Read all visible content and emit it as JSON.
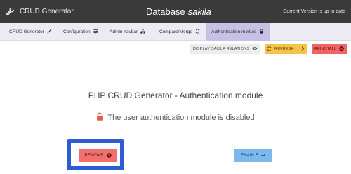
{
  "header": {
    "brand": "CRUD Generator",
    "db_prefix": "Database",
    "db_name": "sakila",
    "version_status": "Current Version is up to date"
  },
  "nav": {
    "items": [
      {
        "label": "CRUD Generator",
        "icon": "magic-wand-icon"
      },
      {
        "label": "Configuration",
        "icon": "sliders-icon"
      },
      {
        "label": "Admin navbar",
        "icon": "sitemap-icon"
      },
      {
        "label": "Compare/Merge",
        "icon": "sync-icon"
      },
      {
        "label": "Authentication module",
        "icon": "lock-icon"
      }
    ],
    "active": "Authentication module"
  },
  "toolbar": {
    "relations_label": "DISPLAY SAKILA RELATIONS",
    "refresh_label": "REFRESH",
    "reinstall_label": "REINSTALL"
  },
  "main": {
    "title": "PHP CRUD Generator - Authentication module",
    "status": "The user authentication module is disabled",
    "remove_label": "REMOVE",
    "enable_label": "ENABLE"
  },
  "colors": {
    "topbar": "#3a3a3a",
    "navbar": "#ecebf4",
    "nav_active": "#c7c1e6",
    "refresh": "#f5c24a",
    "reinstall": "#f26363",
    "remove": "#f07070",
    "enable": "#7ab8ee",
    "highlight": "#2d5bd1",
    "lock_unlocked": "#e0614f"
  }
}
